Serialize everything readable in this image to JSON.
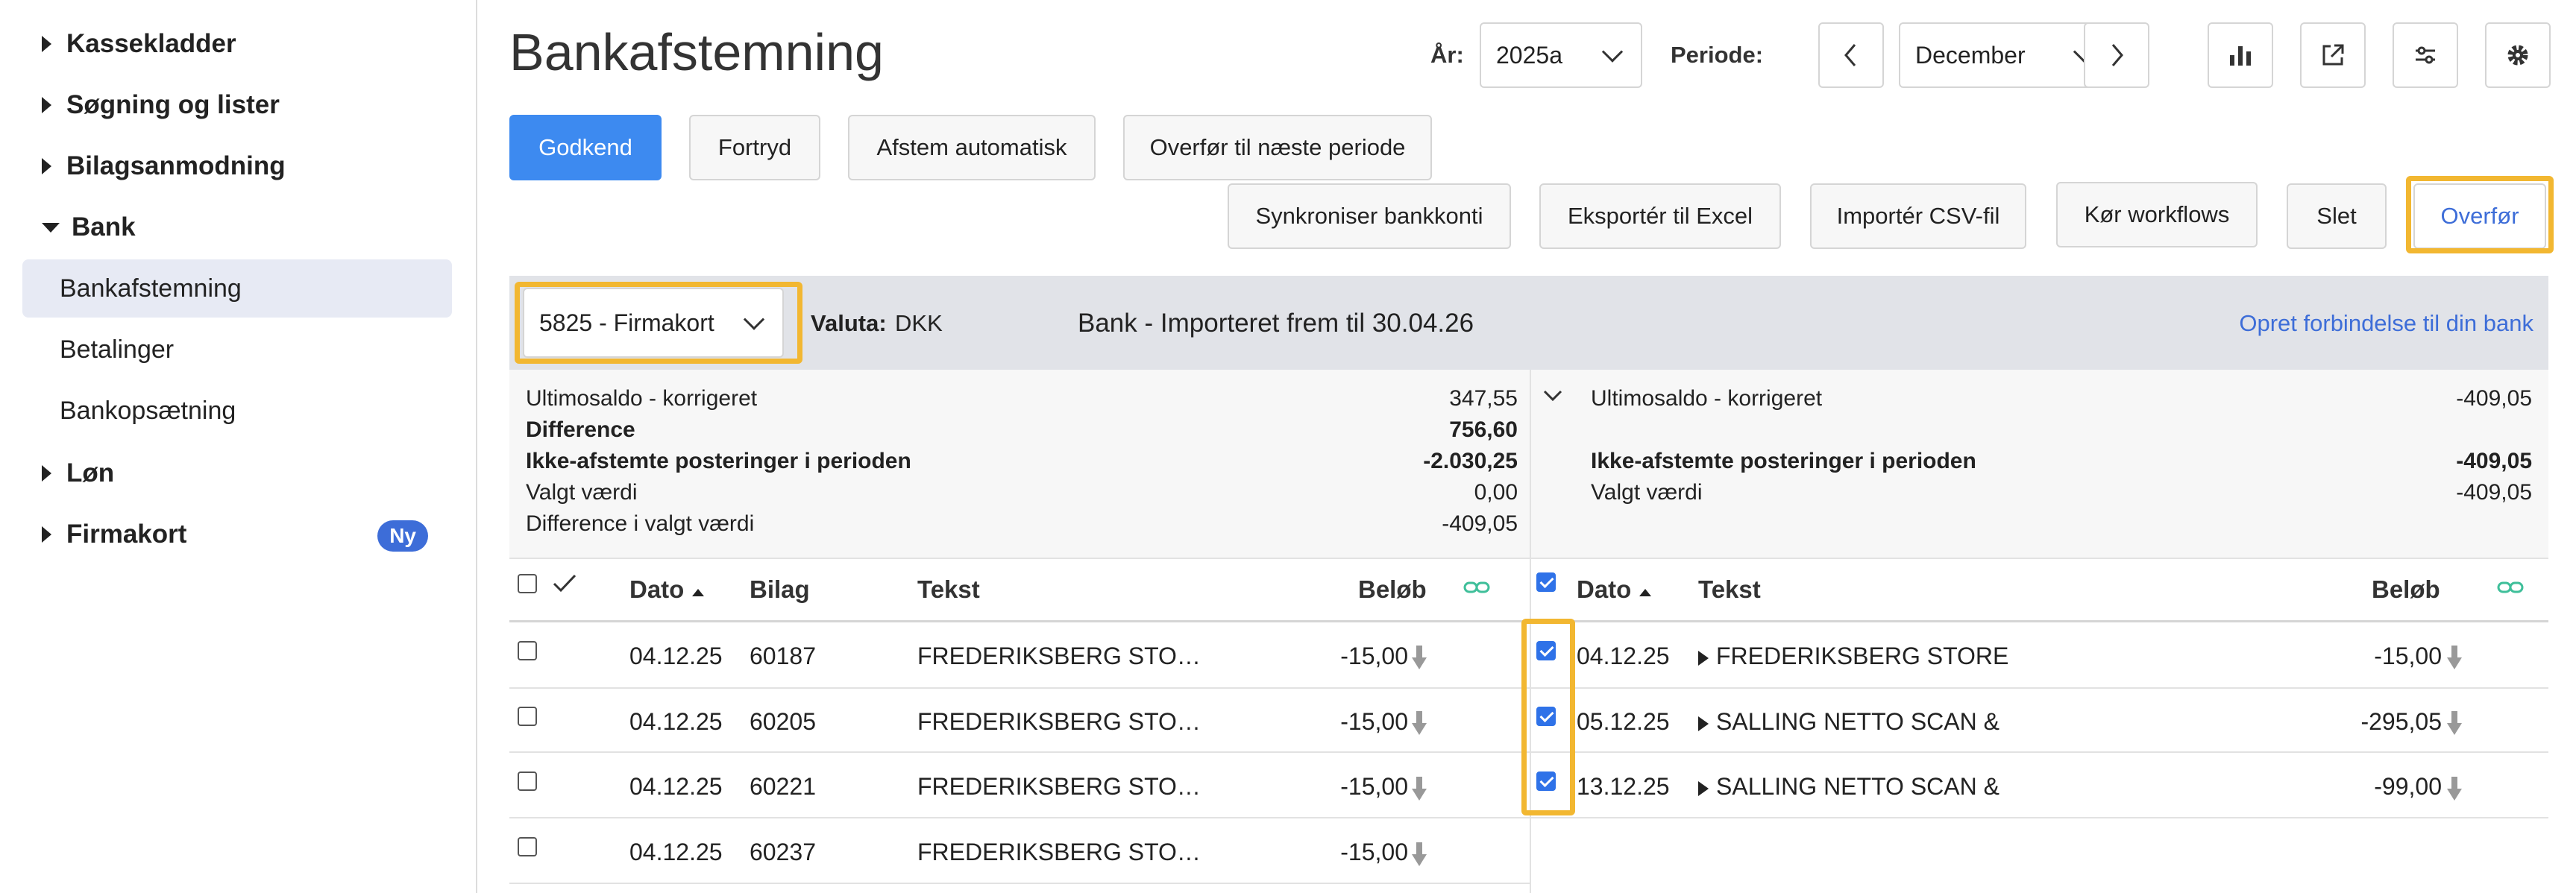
{
  "sidebar": {
    "kassekladder": "Kassekladder",
    "sogning": "Søgning og lister",
    "bilag": "Bilagsanmodning",
    "bank": "Bank",
    "bank_items": [
      "Bankafstemning",
      "Betalinger",
      "Bankopsætning"
    ],
    "lon": "Løn",
    "firmakort": "Firmakort",
    "firmakort_badge": "Ny"
  },
  "header": {
    "title": "Bankafstemning",
    "year_label": "År:",
    "year_value": "2025a",
    "period_label": "Periode:",
    "period_value": "December"
  },
  "toolbar": {
    "godkend": "Godkend",
    "fortryd": "Fortryd",
    "afstem": "Afstem automatisk",
    "overfor_naeste": "Overfør til næste periode",
    "synkroniser": "Synkroniser bankkonti",
    "eksporter": "Eksportér til Excel",
    "importer": "Importér CSV-fil",
    "workflows": "Kør workflows",
    "slet": "Slet",
    "overfor": "Overfør"
  },
  "account": {
    "selected": "5825 - Firmakort",
    "valuta_label": "Valuta:",
    "valuta_value": "DKK",
    "import_status": "Bank - Importeret frem til 30.04.26",
    "connect_link": "Opret forbindelse til din bank"
  },
  "summary_left": {
    "ultimo_label": "Ultimosaldo - korrigeret",
    "ultimo_value": "347,55",
    "diff_label": "Difference",
    "diff_value": "756,60",
    "ikke_label": "Ikke-afstemte posteringer i perioden",
    "ikke_value": "-2.030,25",
    "valgt_label": "Valgt værdi",
    "valgt_value": "0,00",
    "diffvalgt_label": "Difference i valgt værdi",
    "diffvalgt_value": "-409,05"
  },
  "summary_right": {
    "ultimo_label": "Ultimosaldo - korrigeret",
    "ultimo_value": "-409,05",
    "ikke_label": "Ikke-afstemte posteringer i perioden",
    "ikke_value": "-409,05",
    "valgt_label": "Valgt værdi",
    "valgt_value": "-409,05"
  },
  "left_table": {
    "headers": {
      "dato": "Dato",
      "bilag": "Bilag",
      "tekst": "Tekst",
      "belob": "Beløb"
    },
    "rows": [
      {
        "dato": "04.12.25",
        "bilag": "60187",
        "tekst": "FREDERIKSBERG STO…",
        "belob": "-15,00"
      },
      {
        "dato": "04.12.25",
        "bilag": "60205",
        "tekst": "FREDERIKSBERG STO…",
        "belob": "-15,00"
      },
      {
        "dato": "04.12.25",
        "bilag": "60221",
        "tekst": "FREDERIKSBERG STO…",
        "belob": "-15,00"
      },
      {
        "dato": "04.12.25",
        "bilag": "60237",
        "tekst": "FREDERIKSBERG STO…",
        "belob": "-15,00"
      }
    ]
  },
  "right_table": {
    "headers": {
      "dato": "Dato",
      "tekst": "Tekst",
      "belob": "Beløb"
    },
    "rows": [
      {
        "dato": "04.12.25",
        "tekst": "FREDERIKSBERG STORE",
        "belob": "-15,00"
      },
      {
        "dato": "05.12.25",
        "tekst": "SALLING NETTO SCAN &",
        "belob": "-295,05"
      },
      {
        "dato": "13.12.25",
        "tekst": "SALLING NETTO SCAN &",
        "belob": "-99,00"
      }
    ]
  },
  "colors": {
    "primary": "#3d8af0",
    "highlight": "#f2b731",
    "link": "#3d6dd8",
    "link_icon": "#3fbf9a"
  }
}
